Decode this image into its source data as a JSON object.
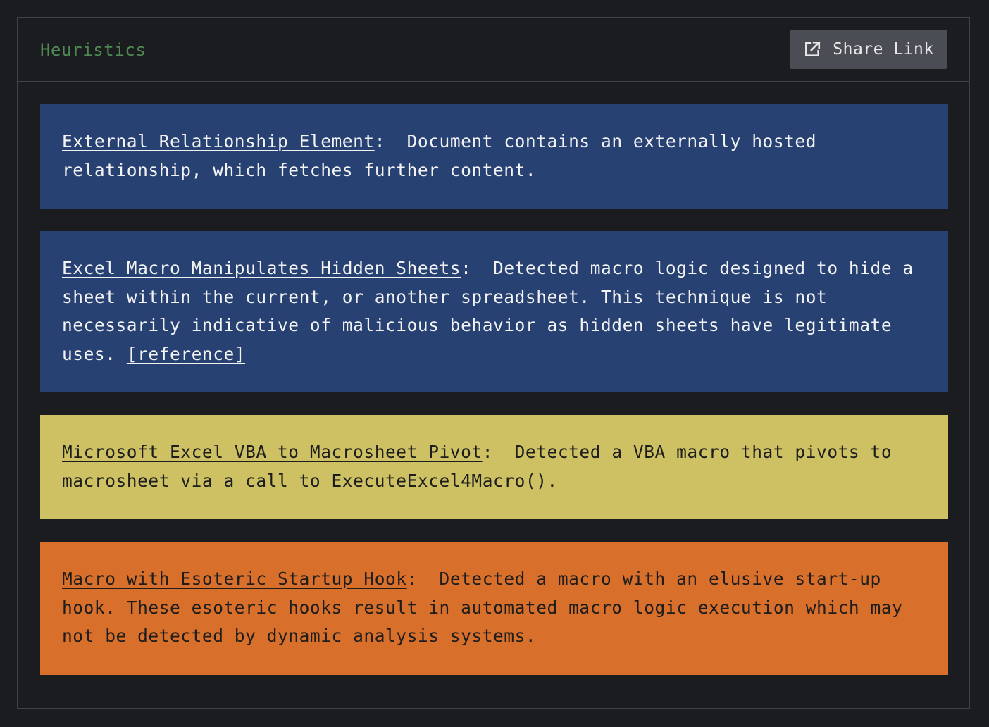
{
  "panel": {
    "title": "Heuristics",
    "share_button": {
      "label": "Share Link",
      "icon": "external-link-icon"
    }
  },
  "findings": [
    {
      "severity": "info",
      "color": "#284173",
      "name": "External Relationship Element",
      "separator": ":  ",
      "description": "Document contains an externally hosted relationship, which fetches further content."
    },
    {
      "severity": "info",
      "color": "#284173",
      "name": "Excel Macro Manipulates Hidden Sheets",
      "separator": ":  ",
      "description": "Detected macro logic designed to hide a sheet within the current, or another spreadsheet. This technique is not necessarily indicative of malicious behavior as hidden sheets have legitimate uses.",
      "reference_label": "[reference]"
    },
    {
      "severity": "low",
      "color": "#cdc163",
      "name": "Microsoft Excel VBA to Macrosheet Pivot",
      "separator": ":  ",
      "description": "Detected a VBA macro that pivots to macrosheet via a call to ExecuteExcel4Macro()."
    },
    {
      "severity": "medium",
      "color": "#d86f2b",
      "name": "Macro with Esoteric Startup Hook",
      "separator": ":  ",
      "description": "Detected a macro with an elusive start-up hook. These esoteric hooks result in automated macro logic execution which may not be detected by dynamic analysis systems."
    }
  ]
}
